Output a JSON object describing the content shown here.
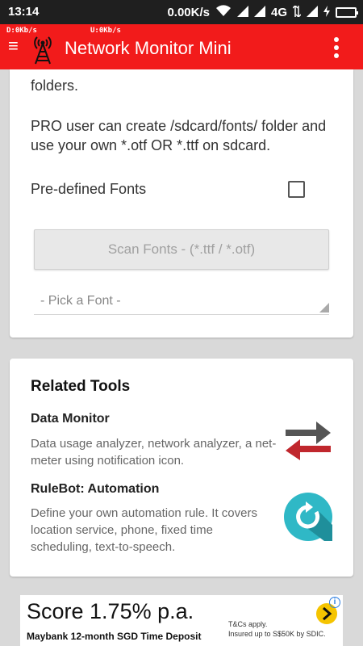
{
  "status_bar": {
    "time": "13:14",
    "net_speed": "0.00K/s",
    "network_type": "4G"
  },
  "app_bar": {
    "download_speed": "D:0Kb/s",
    "upload_speed": "U:0Kb/s",
    "title": "Network Monitor Mini",
    "accent_color": "#f21b1b"
  },
  "fonts_card": {
    "fragment_line": "folders.",
    "pro_text": "PRO user can create /sdcard/fonts/ folder and use your own *.otf OR *.ttf on sdcard.",
    "predefined_label": "Pre-defined Fonts",
    "predefined_checked": false,
    "scan_button_label": "Scan Fonts - (*.ttf / *.otf)",
    "font_picker_value": "- Pick a Font -"
  },
  "related_tools": {
    "heading": "Related Tools",
    "tools": [
      {
        "title": "Data Monitor",
        "description": "Data usage analyzer, network analyzer, a net-meter using notification icon.",
        "icon": "transfer-arrows-icon"
      },
      {
        "title": "RuleBot: Automation",
        "description": "Define your own automation rule. It covers location service, phone, fixed time scheduling, text-to-speech.",
        "icon": "refresh-circle-icon"
      }
    ]
  },
  "ad": {
    "headline": "Score 1.75% p.a.",
    "subline": "Maybank 12-month SGD Time Deposit",
    "tc_line1": "T&Cs apply.",
    "tc_line2": "Insured up to S$50K by SDIC.",
    "info_glyph": "i"
  }
}
